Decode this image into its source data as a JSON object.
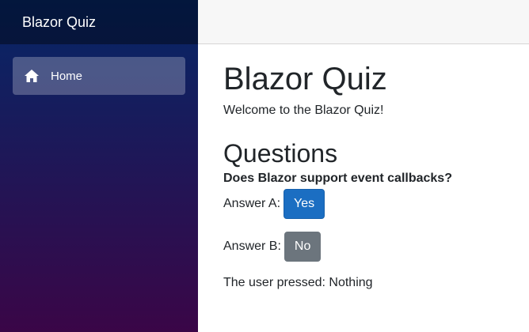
{
  "app": {
    "brand": "Blazor Quiz"
  },
  "sidebar": {
    "items": [
      {
        "label": "Home",
        "icon": "home-icon"
      }
    ]
  },
  "main": {
    "title": "Blazor Quiz",
    "welcome": "Welcome to the Blazor Quiz!",
    "section_title": "Questions",
    "question": "Does Blazor support event callbacks?",
    "answer_a_label": "Answer A:",
    "answer_a_button": "Yes",
    "answer_b_label": "Answer B:",
    "answer_b_button": "No",
    "status_prefix": "The user pressed:",
    "status_value": "Nothing"
  },
  "colors": {
    "sidebar_top": "#052767",
    "sidebar_bottom": "#3a0647",
    "primary": "#1b6ec2",
    "secondary": "#6c757d"
  }
}
